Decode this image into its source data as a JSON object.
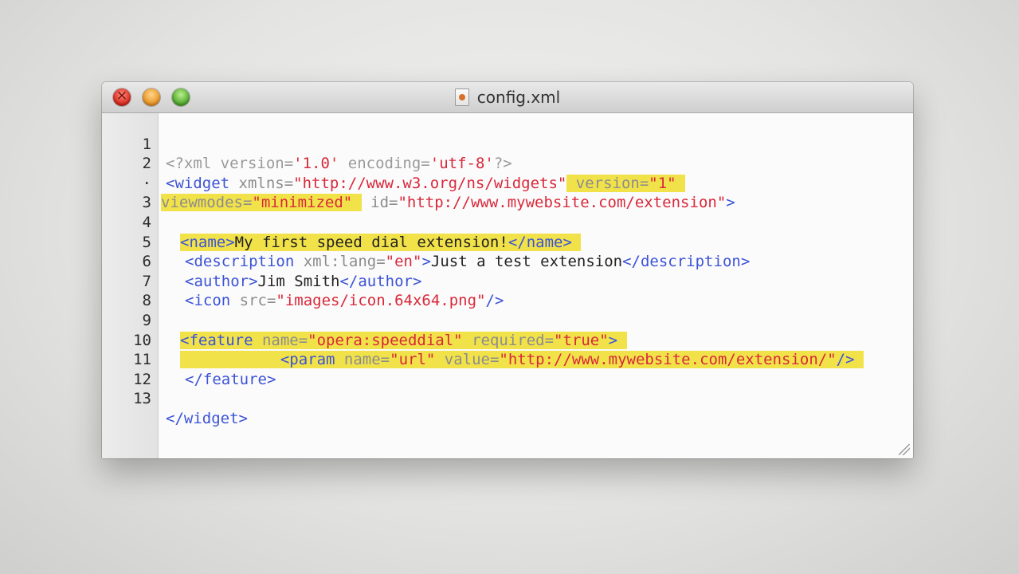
{
  "window": {
    "title": "config.xml",
    "file_icon": "xml-file-icon"
  },
  "editor": {
    "line_numbers": [
      "1",
      "2",
      "·",
      "3",
      "4",
      "5",
      "6",
      "7",
      "8",
      "9",
      "10",
      "11",
      "12",
      "13"
    ],
    "lines": {
      "l1": {
        "a": "<?xml version=",
        "b": "'1.0'",
        "c": " encoding=",
        "d": "'utf-8'",
        "e": "?>"
      },
      "l2": {
        "a": "<widget",
        "b": " xmlns=",
        "c": "\"http://www.w3.org/ns/widgets\"",
        "d": " version=",
        "e": "\"1\""
      },
      "l2c": {
        "a": "viewmodes=",
        "b": "\"minimized\"",
        "c": " id=",
        "d": "\"http://www.mywebsite.com/extension\"",
        "e": ">"
      },
      "l4": {
        "a": "<name>",
        "b": "My first speed dial extension!",
        "c": "</name>"
      },
      "l5": {
        "a": "<description",
        "b": " xml:lang=",
        "c": "\"en\"",
        "d": ">",
        "e": "Just a test extension",
        "f": "</description>"
      },
      "l6": {
        "a": "<author>",
        "b": "Jim Smith",
        "c": "</author>"
      },
      "l7": {
        "a": "<icon",
        "b": " src=",
        "c": "\"images/icon.64x64.png\"",
        "d": "/>"
      },
      "l9": {
        "a": "<feature",
        "b": " name=",
        "c": "\"opera:speeddial\"",
        "d": " required=",
        "e": "\"true\"",
        "f": ">"
      },
      "l10": {
        "a": "<param",
        "b": " name=",
        "c": "\"url\"",
        "d": " value=",
        "e": "\"http://www.mywebsite.com/extension/\"",
        "f": "/>"
      },
      "l11": {
        "a": "</feature>"
      },
      "l13": {
        "a": "</widget>"
      }
    }
  },
  "colors": {
    "tag": "#3b53d6",
    "attribute": "#8c8c8c",
    "value": "#d8283a",
    "highlight": "#f2e24a"
  }
}
